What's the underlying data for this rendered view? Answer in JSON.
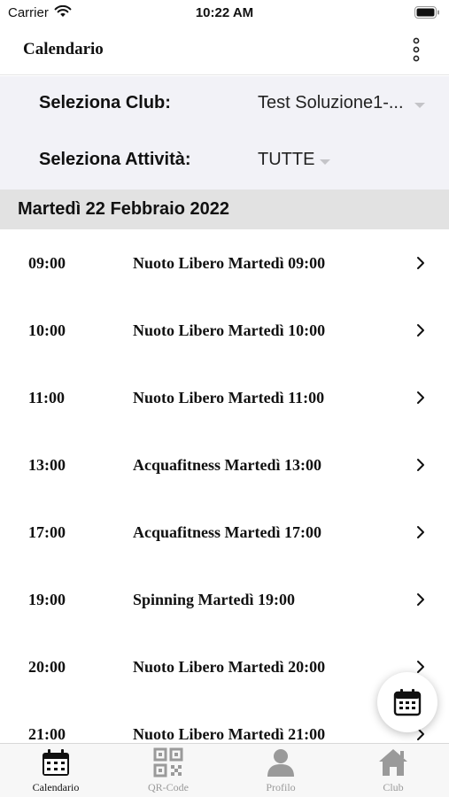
{
  "status_bar": {
    "carrier": "Carrier",
    "time": "10:22 AM"
  },
  "header": {
    "title": "Calendario",
    "menu_icon": "more-vertical-icon"
  },
  "filters": {
    "club_label": "Seleziona Club:",
    "club_value": "Test Soluzione1-...",
    "activity_label": "Seleziona Attività:",
    "activity_value": "TUTTE"
  },
  "date_header": "Martedì 22 Febbraio 2022",
  "events": [
    {
      "time": "09:00",
      "activity": "Nuoto Libero Martedì 09:00"
    },
    {
      "time": "10:00",
      "activity": "Nuoto Libero Martedì 10:00"
    },
    {
      "time": "11:00",
      "activity": "Nuoto Libero Martedì 11:00"
    },
    {
      "time": "13:00",
      "activity": "Acquafitness Martedì 13:00"
    },
    {
      "time": "17:00",
      "activity": "Acquafitness Martedì 17:00"
    },
    {
      "time": "19:00",
      "activity": "Spinning Martedì 19:00"
    },
    {
      "time": "20:00",
      "activity": "Nuoto Libero Martedì 20:00"
    },
    {
      "time": "21:00",
      "activity": "Nuoto Libero Martedì 21:00"
    }
  ],
  "fab": {
    "icon": "calendar-icon"
  },
  "tabs": [
    {
      "label": "Calendario",
      "icon": "calendar-icon",
      "active": true
    },
    {
      "label": "QR-Code",
      "icon": "qr-code-icon",
      "active": false
    },
    {
      "label": "Profilo",
      "icon": "user-icon",
      "active": false
    },
    {
      "label": "Club",
      "icon": "home-icon",
      "active": false
    }
  ],
  "colors": {
    "active_tab": "#111111",
    "inactive_tab": "#9a9a9a",
    "filter_background": "#f2f2f7",
    "date_header_background": "#e2e2e2"
  }
}
